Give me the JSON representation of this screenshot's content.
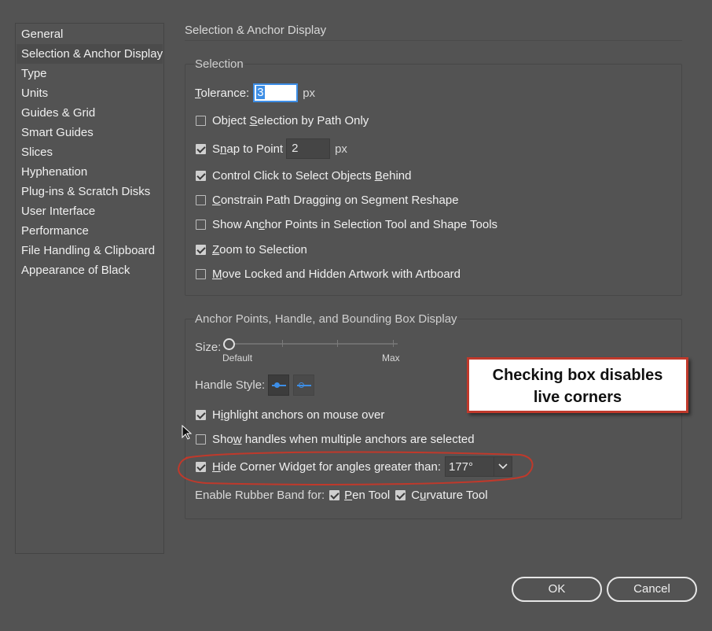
{
  "sidebar": {
    "items": [
      {
        "label": "General"
      },
      {
        "label": "Selection & Anchor Display",
        "selected": true
      },
      {
        "label": "Type"
      },
      {
        "label": "Units"
      },
      {
        "label": "Guides & Grid"
      },
      {
        "label": "Smart Guides"
      },
      {
        "label": "Slices"
      },
      {
        "label": "Hyphenation"
      },
      {
        "label": "Plug-ins & Scratch Disks"
      },
      {
        "label": "User Interface"
      },
      {
        "label": "Performance"
      },
      {
        "label": "File Handling & Clipboard"
      },
      {
        "label": "Appearance of Black"
      }
    ]
  },
  "main": {
    "title": "Selection & Anchor Display",
    "selection": {
      "group_title": "Selection",
      "tolerance_label_u": "T",
      "tolerance_label_rest": "olerance:",
      "tolerance_value": "3",
      "tolerance_unit": "px",
      "object_selection": {
        "pre": "Object ",
        "u": "S",
        "post": "election by Path Only",
        "checked": false
      },
      "snap_to_point": {
        "pre": "S",
        "u": "n",
        "post": "ap to Point",
        "checked": true,
        "value": "2",
        "unit": "px"
      },
      "control_click": {
        "pre": "Control Click to Select Objects ",
        "u": "B",
        "post": "ehind",
        "checked": true
      },
      "constrain_path": {
        "pre": "",
        "u": "C",
        "post": "onstrain Path Dragging on Segment Reshape",
        "checked": false
      },
      "show_anchor_points": {
        "pre": "Show An",
        "u": "c",
        "post": "hor Points in Selection Tool and Shape Tools",
        "checked": false
      },
      "zoom_to_selection": {
        "pre": "",
        "u": "Z",
        "post": "oom to Selection",
        "checked": true
      },
      "move_locked": {
        "pre": "",
        "u": "M",
        "post": "ove Locked and Hidden Artwork with Artboard",
        "checked": false
      }
    },
    "anchor_display": {
      "group_title": "Anchor Points, Handle, and Bounding Box Display",
      "size_label": "Size:",
      "size_min_label": "Default",
      "size_max_label": "Max",
      "size_level": 0,
      "handle_style_label": "Handle Style:",
      "highlight_anchors": {
        "pre": "H",
        "u": "i",
        "post": "ghlight anchors on mouse over",
        "checked": true
      },
      "show_handles": {
        "pre": "Sho",
        "u": "w",
        "post": " handles when multiple anchors are selected",
        "checked": false
      },
      "hide_corner_widget": {
        "pre": "",
        "u": "H",
        "post": "ide Corner Widget for angles greater than:",
        "checked": true,
        "value": "177°"
      },
      "rubber_band_label": "Enable Rubber Band for:",
      "pen_tool": {
        "pre": "",
        "u": "P",
        "post": "en Tool",
        "checked": true
      },
      "curvature_tool": {
        "pre": "C",
        "u": "u",
        "post": "rvature Tool",
        "checked": true
      }
    }
  },
  "callout": {
    "line1": "Checking box disables",
    "line2": "live corners",
    "border_color": "#c0392b"
  },
  "footer": {
    "ok_label": "OK",
    "cancel_label": "Cancel"
  },
  "colors": {
    "background": "#535353",
    "accent": "#3d8ee6",
    "annotation_red": "#c0392b"
  }
}
